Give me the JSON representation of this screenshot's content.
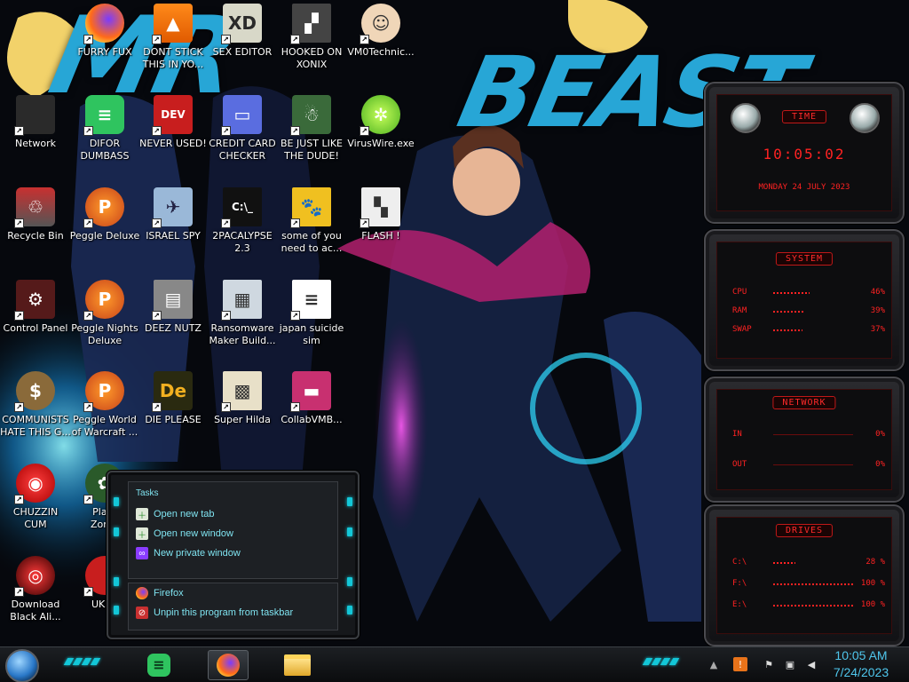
{
  "wallpaper": {
    "headline_left": "MR",
    "headline_right": "BEAST"
  },
  "desktop_icons": [
    {
      "label": "FURRY FUX",
      "icon": "firefox-icon"
    },
    {
      "label": "DONT STICK\nTHIS IN YO...",
      "icon": "vlc-cone-icon"
    },
    {
      "label": "SEX EDITOR",
      "icon": "hex-editor-icon"
    },
    {
      "label": "HOOKED ON\nXONIX",
      "icon": "xonix-game-icon"
    },
    {
      "label": "VM0Technic...",
      "icon": "doctor-avatar-icon"
    },
    {
      "label": "Network",
      "icon": "network-icon"
    },
    {
      "label": "DIFOR\nDUMBASS",
      "icon": "discord-icon"
    },
    {
      "label": "NEVER USED!",
      "icon": "dev-plus-icon"
    },
    {
      "label": "CREDIT CARD\nCHECKER",
      "icon": "credit-card-icon"
    },
    {
      "label": "BE JUST LIKE\nTHE DUDE!",
      "icon": "santa-dude-icon"
    },
    {
      "label": "VirusWire.exe",
      "icon": "lime-icon"
    },
    {
      "label": "Recycle Bin",
      "icon": "recycle-bin-icon"
    },
    {
      "label": "Peggle Deluxe",
      "icon": "peggle-icon"
    },
    {
      "label": "ISRAEL SPY",
      "icon": "spy-icon"
    },
    {
      "label": "2PACALYPSE\n2.3",
      "icon": "terminal-icon"
    },
    {
      "label": "some of you\nneed to ac...",
      "icon": "beaver-icon"
    },
    {
      "label": "FLASH !",
      "icon": "flash-icon"
    },
    {
      "label": "Control Panel",
      "icon": "control-panel-icon"
    },
    {
      "label": "Peggle Nights\nDeluxe",
      "icon": "peggle-icon"
    },
    {
      "label": "DEEZ NUTZ",
      "icon": "windows-stack-icon"
    },
    {
      "label": "Ransomware\nMaker Build...",
      "icon": "window-app-icon"
    },
    {
      "label": "japan suicide\nsim",
      "icon": "document-icon"
    },
    {
      "label": "COMMUNISTS\nHATE THIS G...",
      "icon": "money-bag-icon"
    },
    {
      "label": "Peggle World\nof Warcraft ...",
      "icon": "peggle-icon"
    },
    {
      "label": "DIE PLEASE",
      "icon": "die-icon"
    },
    {
      "label": "Super Hilda",
      "icon": "pixel-hilda-icon"
    },
    {
      "label": "CollabVMB...",
      "icon": "monitor-icon"
    },
    {
      "label": "CHUZZIN\nCUM",
      "icon": "chuzzle-icon"
    },
    {
      "label": "Plant\nZomb",
      "icon": "flower-icon"
    },
    {
      "label": "Download\nBlack Ali...",
      "icon": "alien-orb-icon"
    },
    {
      "label": "UKRA",
      "icon": "ukraine-icon"
    }
  ],
  "gadgets": {
    "time": {
      "title": "TIME",
      "clock": "10:05:02",
      "date": "MONDAY 24 JULY 2023"
    },
    "system": {
      "title": "SYSTEM",
      "rows": [
        {
          "label": "CPU",
          "value": "46%",
          "fill": 0.46
        },
        {
          "label": "RAM",
          "value": "39%",
          "fill": 0.39
        },
        {
          "label": "SWAP",
          "value": "37%",
          "fill": 0.37
        }
      ]
    },
    "network": {
      "title": "NETWORK",
      "rows": [
        {
          "label": "IN",
          "value": "0%"
        },
        {
          "label": "OUT",
          "value": "0%"
        }
      ]
    },
    "drives": {
      "title": "DRIVES",
      "rows": [
        {
          "label": "C:\\",
          "value": "28 %",
          "fill": 0.28
        },
        {
          "label": "F:\\",
          "value": "100 %",
          "fill": 1.0
        },
        {
          "label": "E:\\",
          "value": "100 %",
          "fill": 1.0
        }
      ]
    }
  },
  "jumplist": {
    "section_title": "Tasks",
    "tasks": [
      {
        "label": "Open new tab",
        "icon": "new-tab-icon"
      },
      {
        "label": "Open new window",
        "icon": "new-window-icon"
      },
      {
        "label": "New private window",
        "icon": "private-window-icon"
      }
    ],
    "footer": [
      {
        "label": "Firefox",
        "icon": "firefox-icon"
      },
      {
        "label": "Unpin this program from taskbar",
        "icon": "unpin-icon"
      }
    ]
  },
  "taskbar": {
    "pinned": [
      {
        "name": "discord",
        "icon": "discord-icon"
      },
      {
        "name": "firefox",
        "icon": "firefox-icon",
        "active": true
      },
      {
        "name": "explorer",
        "icon": "folder-icon"
      }
    ],
    "tray": [
      "show-hidden-icon",
      "flag-icon",
      "network-tray-icon",
      "volume-icon"
    ],
    "clock_time": "10:05 AM",
    "clock_date": "7/24/2023"
  },
  "colors": {
    "widget_red": "#ff2222",
    "accent_cyan": "#13c7d8",
    "clock_blue": "#4fc6ec"
  }
}
